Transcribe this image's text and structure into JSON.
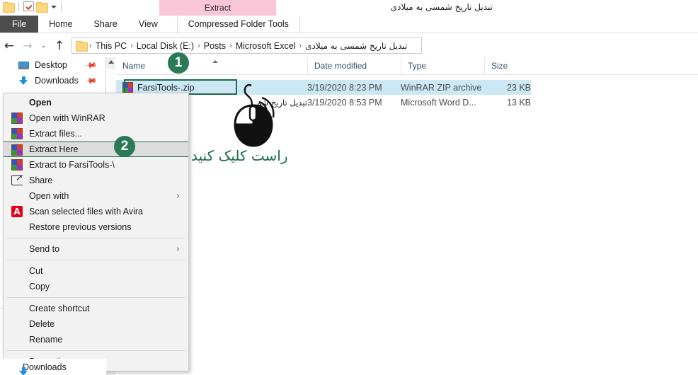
{
  "window": {
    "title": "تبدیل تاریخ شمسی به میلادی",
    "contextual_tab_group": "Extract",
    "quick_access": {
      "folder_icon": "folder-icon",
      "properties_icon": "checkbox-icon",
      "new_folder_icon": "folder-icon",
      "customize_caret": "chevron-down-icon"
    }
  },
  "ribbon": {
    "tabs": [
      {
        "label": "File",
        "active": false,
        "style": "file"
      },
      {
        "label": "Home",
        "active": false,
        "style": "normal"
      },
      {
        "label": "Share",
        "active": false,
        "style": "normal"
      },
      {
        "label": "View",
        "active": false,
        "style": "normal"
      },
      {
        "label": "Compressed Folder Tools",
        "active": true,
        "style": "contextual"
      }
    ]
  },
  "address_bar": {
    "back_icon": "arrow-left-icon",
    "forward_icon": "arrow-right-icon",
    "recent_icon": "chevron-down-icon",
    "up_icon": "arrow-up-icon",
    "folder_icon": "folder-icon",
    "separator": "›",
    "breadcrumbs": [
      "This PC",
      "Local Disk (E:)",
      "Posts",
      "Microsoft Excel",
      "تبدیل تاریخ شمسی به میلادی"
    ]
  },
  "sidebar": {
    "items": [
      {
        "label": "Desktop",
        "icon": "desktop-icon",
        "pinned": true
      },
      {
        "label": "Downloads",
        "icon": "download-icon",
        "pinned": true
      }
    ],
    "bottom_item": {
      "label": "Downloads",
      "icon": "download-icon"
    },
    "scrollbar": {
      "up_arrow": "chevron-up-icon"
    }
  },
  "file_list": {
    "columns": [
      {
        "label": "Name",
        "sorted": true,
        "sort_direction": "ascending"
      },
      {
        "label": "Date modified",
        "sorted": false
      },
      {
        "label": "Type",
        "sorted": false
      },
      {
        "label": "Size",
        "sorted": false
      }
    ],
    "rows": [
      {
        "name": "FarsiTools-.zip",
        "icon": "winrar-archive-icon",
        "date_modified": "3/19/2020 8:23 PM",
        "type": "WinRAR ZIP archive",
        "size": "23 KB",
        "selected": true,
        "rtl": false
      },
      {
        "name": "تبدیل تاریخ شم",
        "icon": "word-document-icon",
        "date_modified": "3/19/2020 8:53 PM",
        "type": "Microsoft Word D...",
        "size": "13 KB",
        "selected": false,
        "rtl": true
      }
    ]
  },
  "context_menu": {
    "items": [
      {
        "label": "Open",
        "icon": null,
        "bold": true,
        "highlighted": false,
        "submenu": false
      },
      {
        "label": "Open with WinRAR",
        "icon": "winrar-icon",
        "bold": false,
        "highlighted": false,
        "submenu": false
      },
      {
        "label": "Extract files...",
        "icon": "winrar-icon",
        "bold": false,
        "highlighted": false,
        "submenu": false
      },
      {
        "label": "Extract Here",
        "icon": "winrar-icon",
        "bold": false,
        "highlighted": true,
        "submenu": false
      },
      {
        "label": "Extract to FarsiTools-\\",
        "icon": "winrar-icon",
        "bold": false,
        "highlighted": false,
        "submenu": false
      },
      {
        "label": "Share",
        "icon": "share-icon",
        "bold": false,
        "highlighted": false,
        "submenu": false
      },
      {
        "label": "Open with",
        "icon": null,
        "bold": false,
        "highlighted": false,
        "submenu": true
      },
      {
        "label": "Scan selected files with Avira",
        "icon": "avira-icon",
        "bold": false,
        "highlighted": false,
        "submenu": false
      },
      {
        "label": "Restore previous versions",
        "icon": null,
        "bold": false,
        "highlighted": false,
        "submenu": false
      },
      {
        "separator": true
      },
      {
        "label": "Send to",
        "icon": null,
        "bold": false,
        "highlighted": false,
        "submenu": true
      },
      {
        "separator": true
      },
      {
        "label": "Cut",
        "icon": null,
        "bold": false,
        "highlighted": false,
        "submenu": false
      },
      {
        "label": "Copy",
        "icon": null,
        "bold": false,
        "highlighted": false,
        "submenu": false
      },
      {
        "separator": true
      },
      {
        "label": "Create shortcut",
        "icon": null,
        "bold": false,
        "highlighted": false,
        "submenu": false
      },
      {
        "label": "Delete",
        "icon": null,
        "bold": false,
        "highlighted": false,
        "submenu": false
      },
      {
        "label": "Rename",
        "icon": null,
        "bold": false,
        "highlighted": false,
        "submenu": false
      },
      {
        "separator": true
      },
      {
        "label": "Properties",
        "icon": null,
        "bold": false,
        "highlighted": false,
        "submenu": false
      }
    ],
    "submenu_arrow": "›"
  },
  "annotations": {
    "step_one": "1",
    "step_two": "2",
    "instruction_text": "راست کلیک کنید",
    "accent_color": "#2b7a56",
    "mouse_illustration": "mouse-right-click-icon"
  },
  "colors": {
    "accent_green": "#2b7a56",
    "contextual_pink": "#f9c6d8",
    "selection_blue": "#cce8f4",
    "file_tab_gray": "#4d4d4d",
    "highlight_gray": "#dcdcdc"
  }
}
